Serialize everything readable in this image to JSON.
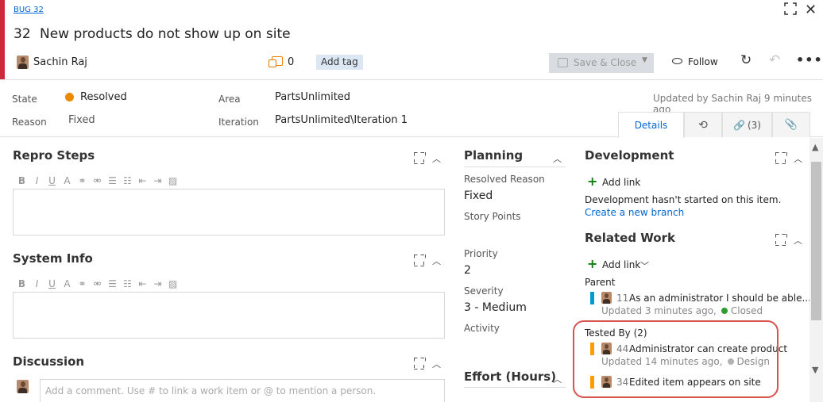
{
  "header": {
    "type_link": "BUG 32",
    "id": "32",
    "title": "New products do not show up on site",
    "owner": "Sachin Raj",
    "comment_count": "0",
    "add_tag": "Add tag",
    "save_label": "Save & Close",
    "follow_label": "Follow",
    "accent_color": "#cc293d"
  },
  "meta": {
    "state_label": "State",
    "state_value": "Resolved",
    "state_color": "#e98a00",
    "reason_label": "Reason",
    "reason_value": "Fixed",
    "area_label": "Area",
    "area_value": "PartsUnlimited",
    "iteration_label": "Iteration",
    "iteration_value": "PartsUnlimited\\Iteration 1",
    "updated": "Updated by Sachin Raj 9 minutes ago"
  },
  "tabs": {
    "details": "Details",
    "links": "(3)"
  },
  "left": {
    "repro_title": "Repro Steps",
    "sysinfo_title": "System Info",
    "discussion_title": "Discussion",
    "comment_placeholder": "Add a comment. Use # to link a work item or @ to mention a person."
  },
  "planning": {
    "title": "Planning",
    "resolved_reason_label": "Resolved Reason",
    "resolved_reason_value": "Fixed",
    "story_points_label": "Story Points",
    "priority_label": "Priority",
    "priority_value": "2",
    "severity_label": "Severity",
    "severity_value": "3 - Medium",
    "activity_label": "Activity",
    "effort_title": "Effort (Hours)"
  },
  "development": {
    "title": "Development",
    "add_link": "Add link",
    "status_text": "Development hasn't started on this item.",
    "create_branch": "Create a new branch"
  },
  "related": {
    "title": "Related Work",
    "add_link": "Add link",
    "parent_label": "Parent",
    "parent": {
      "id": "11",
      "title": "As an administrator I should be able...",
      "updated": "Updated 3 minutes ago,",
      "state": "Closed",
      "state_color": "#339933",
      "bar_color": "#009ccc"
    },
    "tested_by_label": "Tested By (2)",
    "tested": [
      {
        "id": "44",
        "title": "Administrator can create product",
        "updated": "Updated 14 minutes ago,",
        "state": "Design",
        "state_color": "#b2b2b2",
        "bar_color": "#ff9d00"
      },
      {
        "id": "34",
        "title": "Edited item appears on site",
        "bar_color": "#ff9d00"
      }
    ]
  }
}
